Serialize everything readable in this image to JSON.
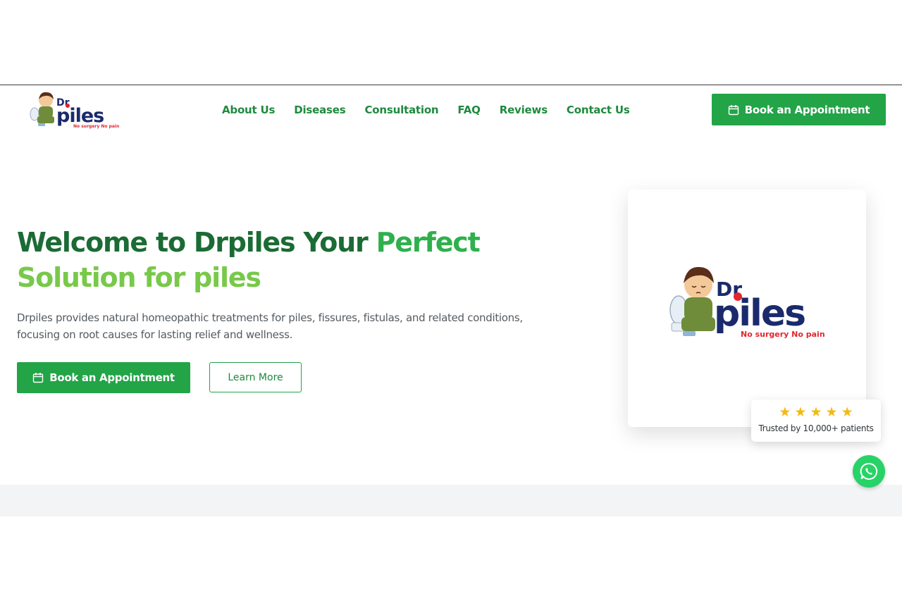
{
  "brand": {
    "logo_dr": "Dr",
    "logo_piles": "piles",
    "logo_tagline": "No surgery No pain"
  },
  "nav": {
    "links": [
      "About Us",
      "Diseases",
      "Consultation",
      "FAQ",
      "Reviews",
      "Contact Us"
    ],
    "cta_label": "Book an Appointment"
  },
  "hero": {
    "title_part1": "Welcome to Drpiles Your ",
    "title_part2": "Perfect",
    "title_part3": "Solution for piles",
    "description": "Drpiles provides natural homeopathic treatments for piles, fissures, fistulas, and related conditions, focusing on root causes for lasting relief and wellness.",
    "book_label": "Book an Appointment",
    "learn_label": "Learn More"
  },
  "trust": {
    "rating": 5,
    "text": "Trusted by 10,000+ patients"
  },
  "colors": {
    "primary": "#22a447",
    "dark_green": "#1b6b34",
    "lime": "#78c94a",
    "logo_navy": "#1a2a6c",
    "logo_red": "#e3262e",
    "star": "#f5b914",
    "whatsapp": "#27d366"
  },
  "icons": {
    "calendar": "calendar-icon",
    "star": "star-icon",
    "whatsapp": "whatsapp-icon"
  }
}
